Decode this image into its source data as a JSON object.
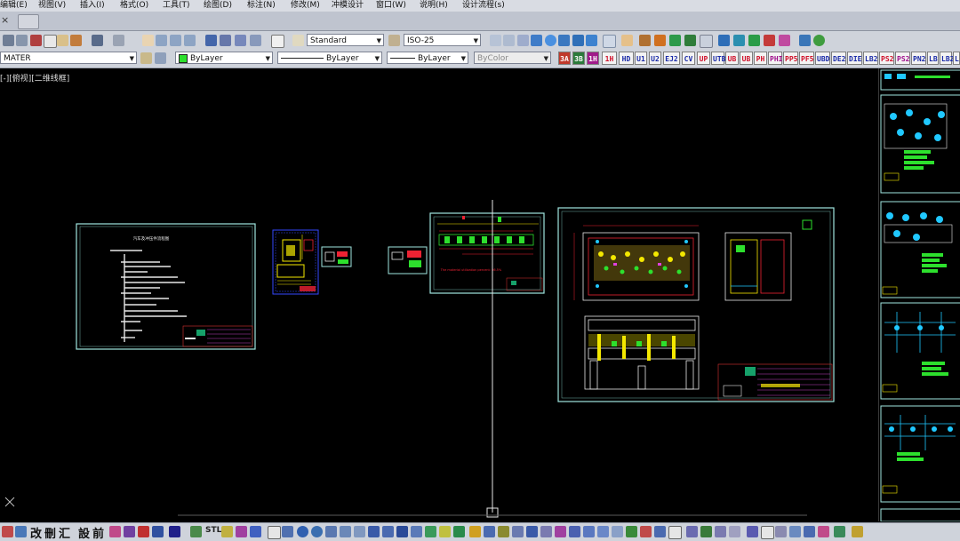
{
  "menu": [
    "编辑(E)",
    "视图(V)",
    "插入(I)",
    "格式(O)",
    "工具(T)",
    "绘图(D)",
    "标注(N)",
    "修改(M)",
    "冲模设计",
    "窗口(W)",
    "说明(H)",
    "设计流程(s)"
  ],
  "tabbar": {
    "close_glyph": "×"
  },
  "toolbar": {
    "text_style": "Standard",
    "dim_style": "ISO-25",
    "layer": "MATER",
    "color": "ByLayer",
    "linetype": "ByLayer",
    "lineweight": "ByLayer",
    "plotstyle": "ByColor"
  },
  "custom_commands": [
    "3A",
    "3B",
    "1H",
    "HD",
    "U1",
    "U2",
    "EJ2",
    "CV",
    "UP",
    "UTB",
    "UB",
    "UB",
    "PH",
    "PHI",
    "PP5",
    "PF5",
    "UBD",
    "DE2",
    "DIE",
    "LB2",
    "PS2",
    "PS2",
    "PN2",
    "LB",
    "LB2",
    "L"
  ],
  "view_label": "[-][俯视][二维线框]",
  "drawing": {
    "sheet1_title": "汽车及冲压件流程图",
    "strip_note": "The material utilization percent: 66.5%"
  },
  "bottom_chars": [
    "改",
    "刪",
    "汇",
    "設",
    "前"
  ],
  "bottom_labels": {
    "stl": "STL"
  },
  "colors": {
    "menubar": "#d9dce3",
    "toolbar": "#cfd3db",
    "canvas": "#000000",
    "frame": "#9fe6e0",
    "crosshair": "#e6e6e6",
    "layer_swatch": "#2de02d",
    "cmd_red": "#d0102a",
    "cmd_blue": "#1a2aa8",
    "cmd_magenta": "#a0108c"
  }
}
